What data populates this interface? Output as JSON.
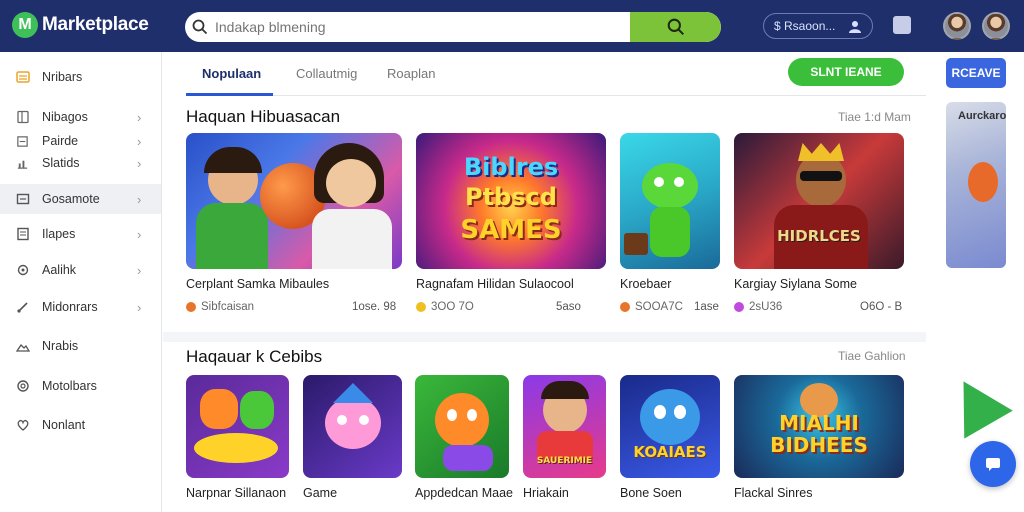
{
  "header": {
    "logo_text": "Marketplace",
    "logo_letter": "M",
    "search_placeholder": "Indakap blmening",
    "account_label": "$ Rsaoon..."
  },
  "sidebar": {
    "items": [
      {
        "label": "Nribars",
        "icon": "list-icon"
      },
      {
        "label": "Nibagos",
        "icon": "book-icon"
      },
      {
        "label": "Pairde",
        "icon": "file-icon"
      },
      {
        "label": "Slatids",
        "icon": "chart-icon"
      },
      {
        "label": "Gosamote",
        "icon": "box-icon"
      },
      {
        "label": "Ilapes",
        "icon": "doc-icon"
      },
      {
        "label": "Aalihk",
        "icon": "gear-icon"
      },
      {
        "label": "Midonrars",
        "icon": "brush-icon"
      },
      {
        "label": "Nrabis",
        "icon": "image-icon"
      },
      {
        "label": "Motolbars",
        "icon": "settings-icon"
      },
      {
        "label": "Nonlant",
        "icon": "heart-icon"
      }
    ]
  },
  "tabs": [
    {
      "label": "Nopulaan"
    },
    {
      "label": "Collautmig"
    },
    {
      "label": "Roaplan"
    }
  ],
  "cta_primary": "SLNT IEANE",
  "cta_secondary": "RCEAVE",
  "section1": {
    "title": "Haquan Hibuasacan",
    "link": "Tiae 1:d Mam",
    "cards": [
      {
        "title": "Cerplant Samka Mibaules",
        "meta": "Sibfcaisan",
        "price": "1ose. 98",
        "dot": "#e8742a",
        "art": "kids"
      },
      {
        "title": "Ragnafam Hilidan Sulaocool",
        "meta": "3OO 7O",
        "price": "5aso",
        "dot": "#f0c020",
        "art": "Biblres Ptbscd SAMES"
      },
      {
        "title": "Kroebaer",
        "meta": "SOOA7C",
        "price": "1ase",
        "dot": "#e8742a",
        "art": "robot"
      },
      {
        "title": "Kargiay Siylana Some",
        "meta": "2sU36",
        "price": "O6O - B",
        "dot": "#c04ae0",
        "art": "HIBICARS HIDRLCES"
      }
    ]
  },
  "section2": {
    "title": "Haqauar k Cebibs",
    "link": "Tiae Gahlion",
    "cards": [
      {
        "title": "Narpnar Sillanaon",
        "dot": "#e8742a",
        "art": "fox"
      },
      {
        "title": "Game",
        "dot": "#e84a4a",
        "art": "pink"
      },
      {
        "title": "Appdedcan Maae",
        "dot": "#c04ae0",
        "art": "orange"
      },
      {
        "title": "Hriakain",
        "dot": "#e84a4a",
        "art": "SAUERIMIE"
      },
      {
        "title": "Bone Soen",
        "dot": "#7cc33a",
        "art": "KOAIAES"
      },
      {
        "title": "Flackal Sinres",
        "dot": "#c04ae0",
        "art": "MIALHI BIDHEES"
      }
    ]
  },
  "right_peek_label": "Aurckaro",
  "colors": {
    "header_bg": "#1f2f6b",
    "accent_green": "#3bbf3b",
    "accent_blue": "#3a66e0"
  }
}
